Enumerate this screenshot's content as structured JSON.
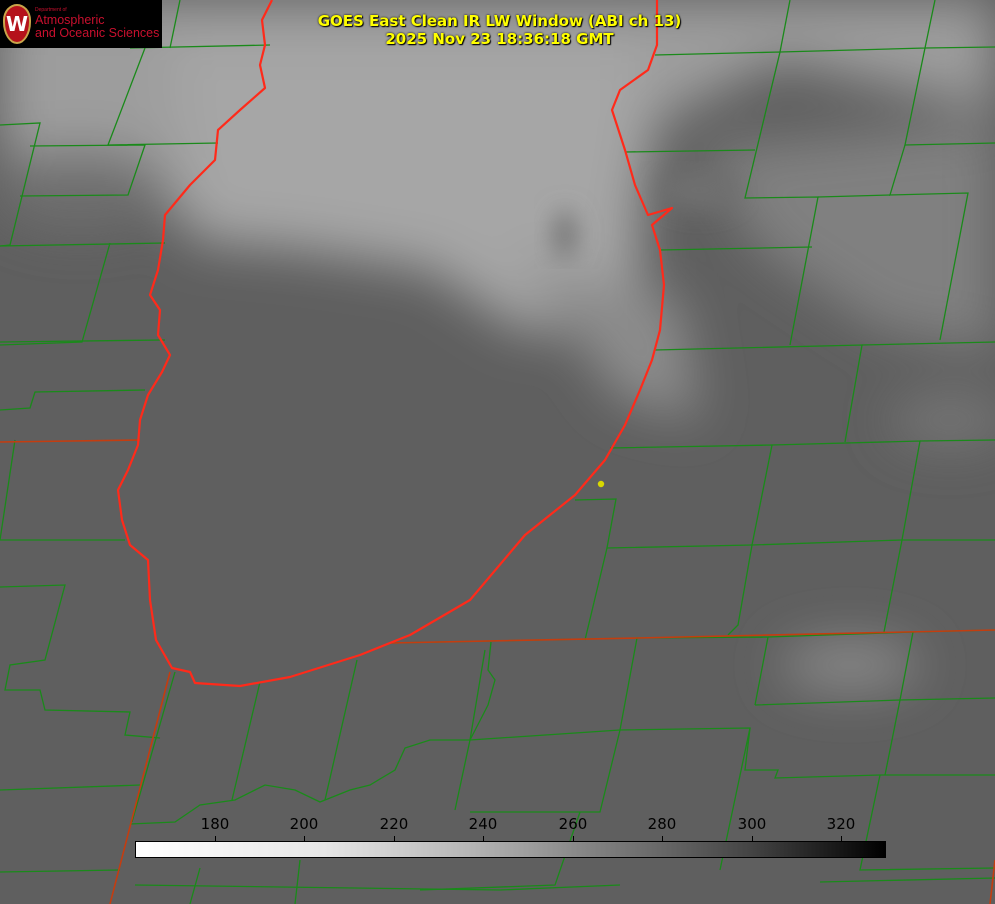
{
  "logo": {
    "small_text": "Department of",
    "line1": "Atmospheric",
    "line2": "and Oceanic Sciences",
    "seal_letter": "W"
  },
  "title": {
    "line1": "GOES East Clean IR LW Window (ABI ch 13)",
    "line2": "2025 Nov 23 18:36:18 GMT"
  },
  "colorbar": {
    "units_range": [
      162,
      330
    ],
    "ticks": [
      "180",
      "200",
      "220",
      "240",
      "260",
      "280",
      "300",
      "320"
    ],
    "colormap": "white-to-black (cold bright, warm dark)"
  },
  "colors": {
    "lake_outline": "#ff2a1a",
    "county_lines": "#1a8a1a",
    "title_text": "#ffff00",
    "marker": "#d8d800"
  }
}
